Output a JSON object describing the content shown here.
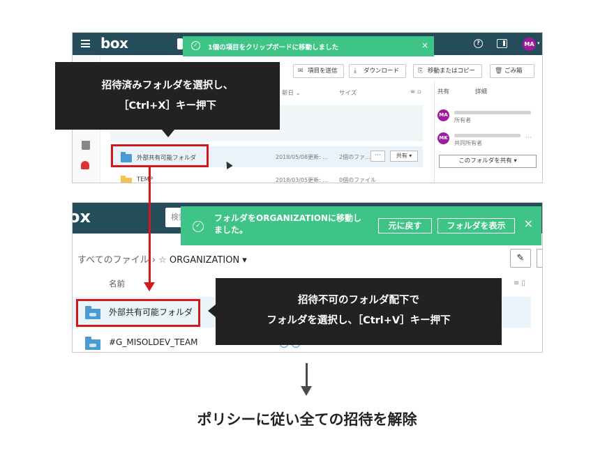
{
  "shot1": {
    "logo": "box",
    "avatar": "MA",
    "toast": {
      "message": "1個の項目をクリップボードに移動しました",
      "close": "×"
    },
    "toolbar": {
      "send": "項目を送信",
      "download": "ダウンロード",
      "move_copy": "移動またはコピー",
      "trash": "ごみ箱"
    },
    "columns": {
      "updated": "新日 ⌄",
      "size": "サイズ",
      "list_view": "≡ ▫"
    },
    "rows": [
      {
        "name": "外部共有可能フォルダ",
        "date": "2018/05/08更新: ...",
        "size": "2個のファ...",
        "more": "···",
        "share": "共有 ▾"
      },
      {
        "name": "TEMP",
        "date": "2018/03/05更新: ...",
        "size": "0個のファイル"
      }
    ],
    "side": {
      "tab_shared": "共有",
      "tab_details": "詳細",
      "users": [
        {
          "initials": "MA",
          "role": "所有者"
        },
        {
          "initials": "MK",
          "role": "共同所有者",
          "more": "···"
        }
      ],
      "share_button": "このフォルダを共有 ▾"
    }
  },
  "shot2": {
    "logo": "ox",
    "search": "検索",
    "toast": {
      "message": "フォルダをORGANIZATIONに移動しました。",
      "undo": "元に戻す",
      "show": "フォルダを表示",
      "close": "×"
    },
    "breadcrumb": {
      "all_files": "すべてのファイル",
      "sep": "›",
      "star": "☆",
      "current": "ORGANIZATION ▾"
    },
    "header_name": "名前",
    "header_right": "≡ ▯",
    "rows": [
      {
        "name": "外部共有可能フォルダ"
      },
      {
        "name": "#G_MISOLDEV_TEAM"
      }
    ]
  },
  "callouts": {
    "first": {
      "line1": "招待済みフォルダを選択し、",
      "line2": "［Ctrl+X］キー押下"
    },
    "second": {
      "line1": "招待不可のフォルダ配下で",
      "line2": "フォルダを選択し、［Ctrl+V］キー押下"
    }
  },
  "conclusion": "ポリシーに従い全ての招待を解除",
  "colors": {
    "box_header": "#244c5a",
    "toast_green": "#3ec486",
    "highlight_red": "#d4171e",
    "callout_bg": "#222222"
  }
}
